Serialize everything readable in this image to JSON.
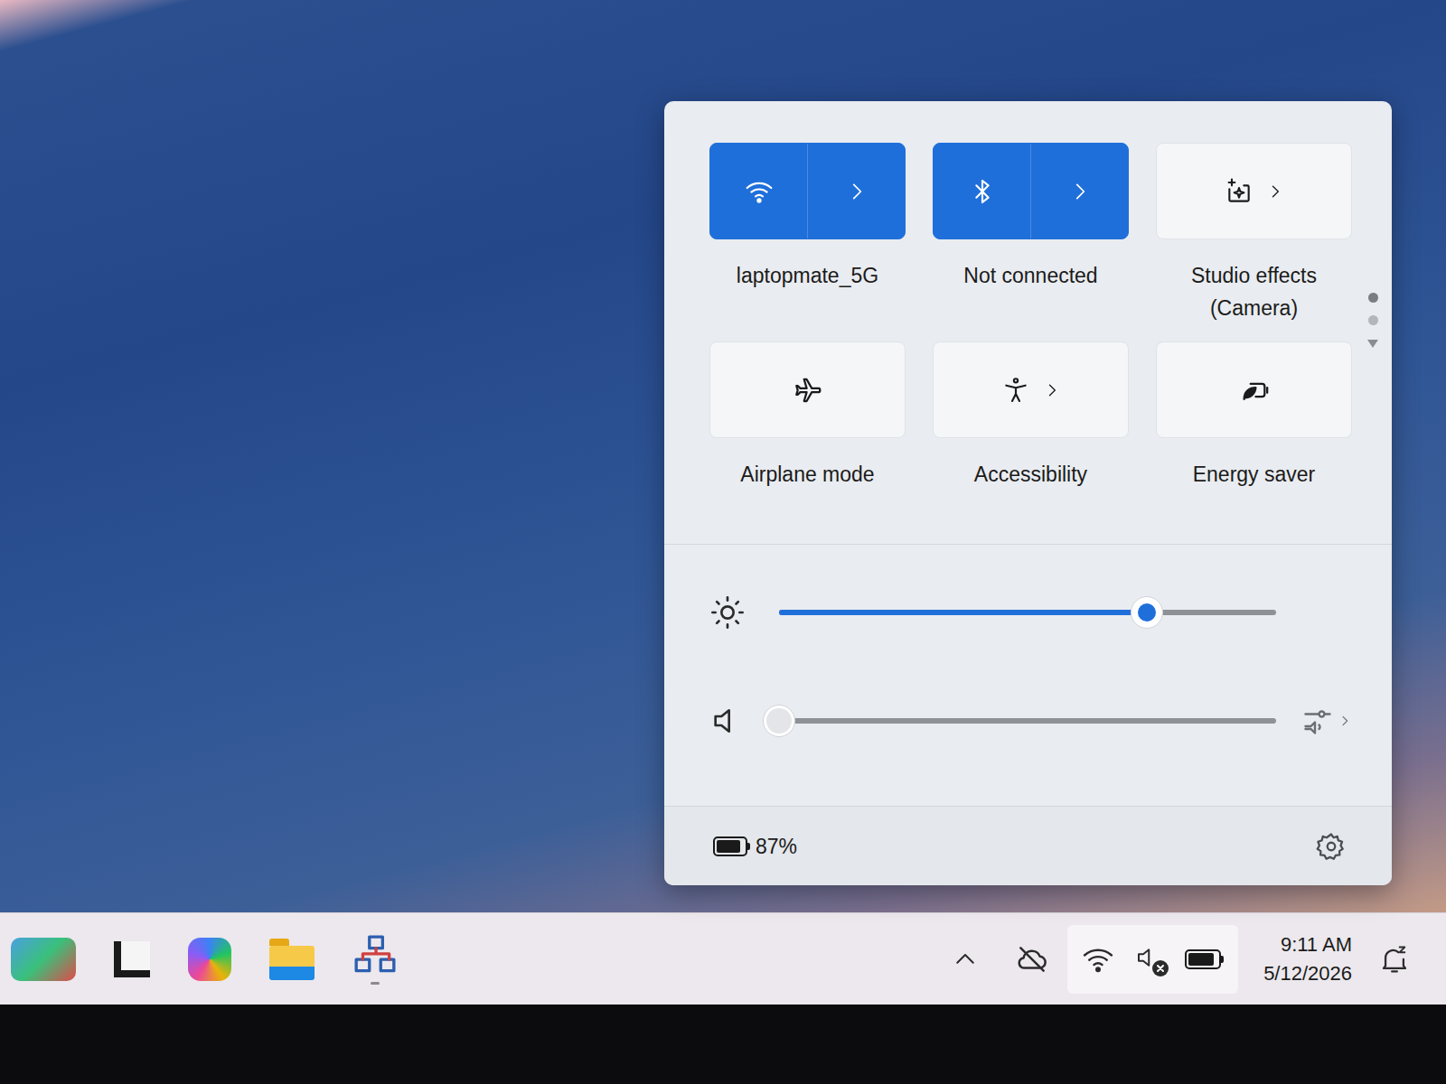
{
  "quick_settings": {
    "tiles": [
      {
        "label": "laptopmate_5G",
        "kind": "split",
        "on": true
      },
      {
        "label": "Not connected",
        "kind": "split",
        "on": true
      },
      {
        "label": "Studio effects (Camera)",
        "kind": "expand",
        "on": false
      },
      {
        "label": "Airplane mode",
        "kind": "toggle",
        "on": false
      },
      {
        "label": "Accessibility",
        "kind": "expand",
        "on": false
      },
      {
        "label": "Energy saver",
        "kind": "toggle",
        "on": false
      }
    ],
    "pages": [
      {
        "selected": true
      },
      {
        "selected": false
      }
    ],
    "brightness": {
      "level": 0.74
    },
    "volume": {
      "level": 0,
      "muted": true
    },
    "battery": {
      "reading": "87%",
      "level": 0.87
    }
  },
  "taskbar": {
    "time": "9:11 AM",
    "date": "5/12/2026"
  }
}
